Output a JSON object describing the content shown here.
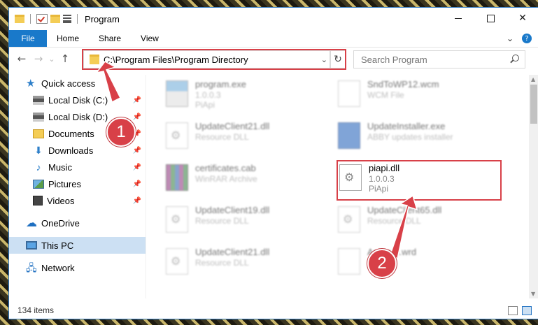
{
  "window": {
    "title": "Program",
    "minimize_glyph": "—",
    "maximize_glyph": "☐",
    "close_glyph": "✕"
  },
  "ribbon": {
    "file_tab": "File",
    "tabs": [
      "Home",
      "Share",
      "View"
    ],
    "expand_glyph": "⌄",
    "help_glyph": "?"
  },
  "nav": {
    "back_glyph": "←",
    "forward_glyph": "→",
    "recent_glyph": "⌄",
    "up_glyph": "↑",
    "address": "C:\\Program Files\\Program Directory",
    "address_chevron": "⌄",
    "refresh_glyph": "↻",
    "search_placeholder": "Search Program"
  },
  "sidebar": {
    "quick_access": "Quick access",
    "items": [
      {
        "label": "Local Disk (C:)",
        "icon": "drive-icon"
      },
      {
        "label": "Local Disk (D:)",
        "icon": "drive-icon"
      },
      {
        "label": "Documents",
        "icon": "documents-icon"
      },
      {
        "label": "Downloads",
        "icon": "downloads-icon"
      },
      {
        "label": "Music",
        "icon": "music-icon"
      },
      {
        "label": "Pictures",
        "icon": "pictures-icon"
      },
      {
        "label": "Videos",
        "icon": "videos-icon"
      }
    ],
    "pin_glyph": "📌",
    "onedrive": "OneDrive",
    "this_pc": "This PC",
    "network": "Network"
  },
  "files": {
    "col1": [
      {
        "name": "program.exe",
        "line2": "1.0.0.3",
        "line3": "PiApi",
        "icon": "exe-icon"
      },
      {
        "name": "UpdateClient21.dll",
        "line2": "Resource DLL",
        "line3": "",
        "icon": "dll-icon"
      },
      {
        "name": "certificates.cab",
        "line2": "WinRAR Archive",
        "line3": "",
        "icon": "archive-icon"
      },
      {
        "name": "UpdateClient19.dll",
        "line2": "Resource DLL",
        "line3": "",
        "icon": "dll-icon"
      },
      {
        "name": "UpdateClient21.dll",
        "line2": "Resource DLL",
        "line3": "",
        "icon": "dll-icon"
      }
    ],
    "col2": [
      {
        "name": "SndToWP12.wcm",
        "line2": "WCM File",
        "line3": "",
        "icon": "file-icon"
      },
      {
        "name": "UpdateInstaller.exe",
        "line2": "ABBY updates installer",
        "line3": "",
        "icon": "installer-icon"
      },
      {
        "name": "UpdateClient65.dll",
        "line2": "Resource DLL",
        "line3": "",
        "icon": "dll-icon"
      },
      {
        "name": "Autorun.wrd",
        "line2": "",
        "line3": "",
        "icon": "file-icon"
      }
    ],
    "highlighted": {
      "name": "piapi.dll",
      "line2": "1.0.0.3",
      "line3": "PiApi",
      "icon": "dll-icon"
    }
  },
  "status": {
    "item_count": "134 items"
  },
  "annotations": {
    "step1": "1",
    "step2": "2",
    "accent": "#d84048"
  }
}
